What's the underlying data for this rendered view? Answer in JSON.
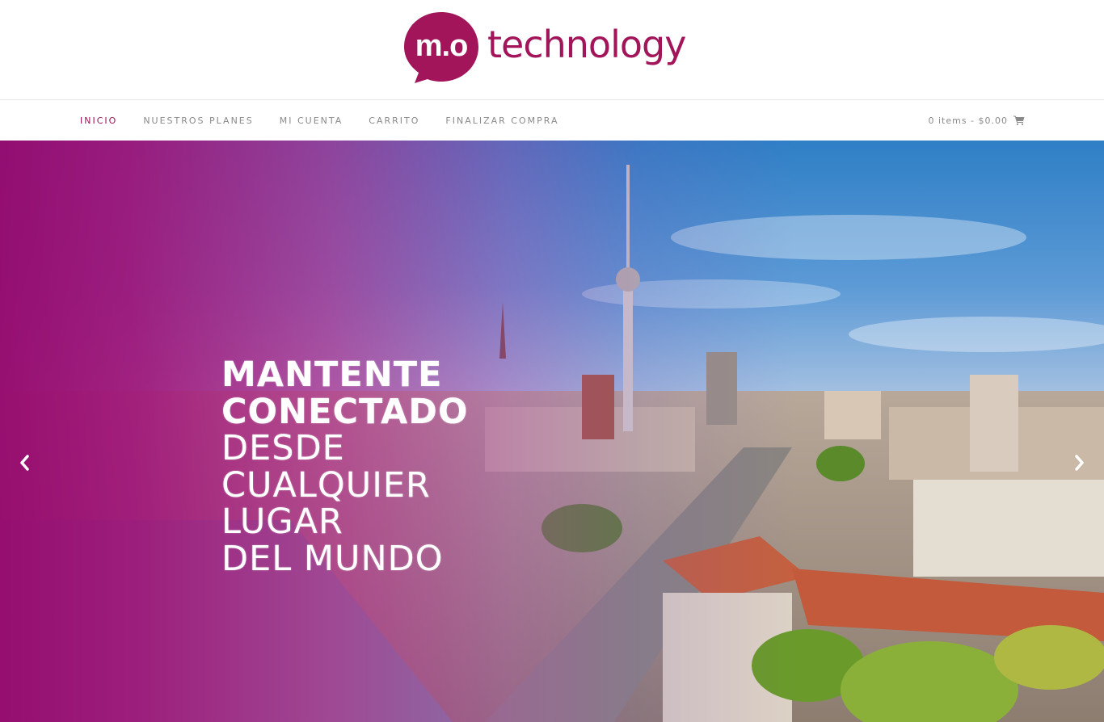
{
  "brand": {
    "logo_mark": "m.o",
    "logo_word": "technology",
    "color": "#a2155a"
  },
  "nav": {
    "items": [
      {
        "label": "INICIO",
        "active": true
      },
      {
        "label": "NUESTROS PLANES",
        "active": false
      },
      {
        "label": "MI CUENTA",
        "active": false
      },
      {
        "label": "CARRITO",
        "active": false
      },
      {
        "label": "FINALIZAR COMPRA",
        "active": false
      }
    ],
    "cart_label": "0 items - $0.00",
    "cart_icon": "shopping-cart-icon"
  },
  "hero": {
    "lines": [
      {
        "text": "MANTENTE",
        "bold": true
      },
      {
        "text": "CONECTADO",
        "bold": true
      },
      {
        "text": "DESDE",
        "bold": false
      },
      {
        "text": "CUALQUIER",
        "bold": false
      },
      {
        "text": "LUGAR",
        "bold": false
      },
      {
        "text": "DEL MUNDO",
        "bold": false
      }
    ],
    "prev_icon": "chevron-left-icon",
    "next_icon": "chevron-right-icon",
    "overlay_color": "#a0147a"
  }
}
